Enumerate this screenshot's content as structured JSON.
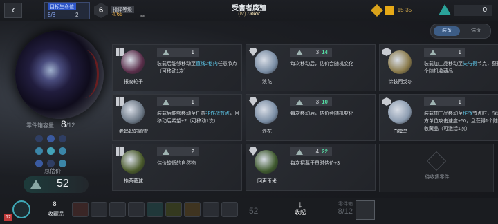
{
  "header": {
    "target_title": "目标生命值",
    "target_hp": "8/8",
    "target_shield": "2",
    "level": "6",
    "command_title": "指挥等级",
    "command_value": "4/65",
    "title": "受害者腐殖",
    "subtitle_prefix": "(IV)",
    "subtitle_name": "Dolor",
    "resource_gold": "·15·35",
    "resource_gem": "0"
  },
  "toggle": {
    "a": "装备",
    "b": "估价"
  },
  "left": {
    "parts_label": "零件箱容量",
    "parts_value": "8",
    "parts_max": "/12",
    "total_label": "总估价",
    "total_value": "52",
    "dot_colors": [
      "#2f3e63",
      "#3a5aa0",
      "#2f3e63",
      "#3b86a8",
      "#43a3b8",
      "#3b86a8",
      "#3a5aa0",
      "#2f3e63",
      "#3b86a8"
    ]
  },
  "cards": [
    {
      "name": "报废轮子",
      "type": "twin",
      "price": "1",
      "old": "",
      "desc": [
        {
          "t": "装载后能够移动至"
        },
        {
          "t": "直线2格内",
          "h": 1
        },
        {
          "t": "任意节点（可移动1次）"
        }
      ],
      "color": "#5a2e4a"
    },
    {
      "name": "浪花",
      "type": "gem",
      "price": "",
      "old": "3",
      "new": "14",
      "desc": [
        {
          "t": "每次移动后，估价会随机变化"
        }
      ],
      "color": "#7a8da4"
    },
    {
      "name": "涂装阿戈尔",
      "type": "box",
      "price": "1",
      "old": "",
      "desc": [
        {
          "t": "装载加工品移动至"
        },
        {
          "t": "失与得",
          "h": 1
        },
        {
          "t": "节点，获得2个随机收藏品"
        }
      ],
      "color": "#8a7a4a"
    },
    {
      "name": "老妈妈的鼬雪",
      "type": "twin",
      "price": "1",
      "old": "",
      "desc": [
        {
          "t": "装载后能够移动至任意"
        },
        {
          "t": "非作战节点",
          "h": 1
        },
        {
          "t": "，且移动后希望+2（可移动1次）"
        }
      ],
      "color": "#6c7886"
    },
    {
      "name": "浪花",
      "type": "gem",
      "price": "",
      "old": "3",
      "new": "10",
      "desc": [
        {
          "t": "每次移动后，估价会随机变化"
        }
      ],
      "color": "#7a8da4"
    },
    {
      "name": "白模鸟",
      "type": "box",
      "price": "1",
      "old": "",
      "desc": [
        {
          "t": "装载加工品移动至"
        },
        {
          "t": "作战",
          "h": 1
        },
        {
          "t": "节点时，战斗我方单位攻击速度+50，且获得1个随机收藏品（可激活1次）"
        }
      ],
      "color": "#8c9cb0"
    },
    {
      "name": "梏苔藓球",
      "type": "twin",
      "price": "2",
      "old": "",
      "desc": [
        {
          "t": "估价较低的自然物"
        }
      ],
      "color": "#4a5a2a"
    },
    {
      "name": "回声玉米",
      "type": "gem",
      "price": "",
      "old": "4",
      "new": "22",
      "desc": [
        {
          "t": "每次招募干员时估价+3"
        }
      ],
      "color": "#3f5a2e"
    }
  ],
  "empty_card": "待收集零件",
  "bottom": {
    "badge": "12",
    "collection_count": "8",
    "collection_label": "收藏品",
    "dim_value": "52",
    "stow_label": "收起",
    "parts_label": "零件箱",
    "parts_value": "8/12"
  }
}
